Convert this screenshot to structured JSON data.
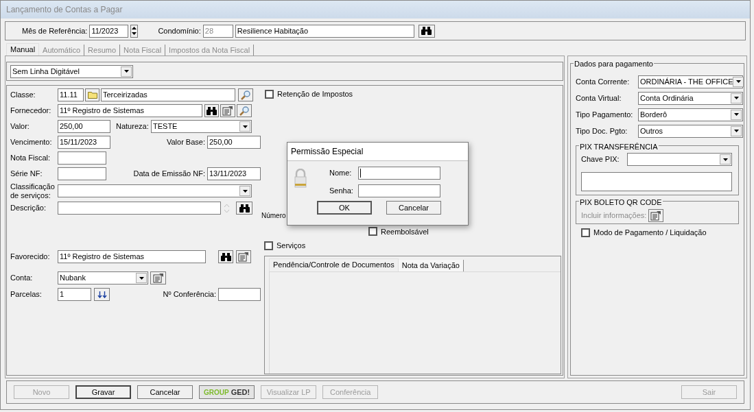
{
  "window": {
    "title": "Lançamento de Contas a Pagar"
  },
  "header": {
    "month_label": "Mês de Referência:",
    "month_value": "11/2023",
    "condo_label": "Condomínio:",
    "condo_code": "28",
    "condo_name": "Resilience Habitação"
  },
  "tabs": [
    {
      "label": "Manual",
      "selected": true
    },
    {
      "label": "Automático",
      "selected": false
    },
    {
      "label": "Resumo",
      "selected": false
    },
    {
      "label": "Nota Fiscal",
      "selected": false
    },
    {
      "label": "Impostos da Nota Fiscal",
      "selected": false
    }
  ],
  "line_type": {
    "value": "Sem Linha Digitável"
  },
  "form": {
    "classe": {
      "label": "Classe:",
      "code": "11.11",
      "name": "Terceirizadas"
    },
    "fornecedor": {
      "label": "Fornecedor:",
      "value": "11º Registro de Sistemas"
    },
    "valor": {
      "label": "Valor:",
      "value": "250,00"
    },
    "natureza": {
      "label": "Natureza:",
      "value": "TESTE"
    },
    "vencimento": {
      "label": "Vencimento:",
      "value": "15/11/2023"
    },
    "valor_base": {
      "label": "Valor Base:",
      "value": "250,00"
    },
    "nota_fiscal": {
      "label": "Nota Fiscal:"
    },
    "serie_nf": {
      "label": "Série NF:"
    },
    "data_emissao": {
      "label": "Data de Emissão NF:",
      "value": "13/11/2023"
    },
    "classificacao": {
      "label": "Classificação de serviços:"
    },
    "descricao": {
      "label": "Descrição:"
    },
    "favorecido": {
      "label": "Favorecido:",
      "value": "11º Registro de Sistemas"
    },
    "conta": {
      "label": "Conta:",
      "value": "Nubank"
    },
    "parcelas": {
      "label": "Parcelas:",
      "value": "1"
    },
    "conferencia": {
      "label": "Nº Conferência:"
    }
  },
  "options": {
    "retencao": {
      "label": "Retenção de Impostos",
      "checked": false
    },
    "numero_label": "Número",
    "reembolsavel": {
      "label": "Reembolsável",
      "checked": false
    },
    "servicos": {
      "label": "Serviços",
      "checked": false
    }
  },
  "subtabs": [
    {
      "label": "Pendência/Controle de Documentos",
      "selected": true
    },
    {
      "label": "Nota da Variação",
      "selected": false
    }
  ],
  "dialog": {
    "title": "Permissão Especial",
    "fields": [
      {
        "label": "Nome:"
      },
      {
        "label": "Senha:"
      }
    ],
    "buttons": [
      {
        "label": "OK",
        "default": true
      },
      {
        "label": "Cancelar",
        "default": false
      }
    ]
  },
  "payment": {
    "title": "Dados para pagamento",
    "selects": [
      {
        "label": "Conta Corrente:",
        "value": "ORDINÁRIA - THE OFFICE"
      },
      {
        "label": "Conta Virtual:",
        "value": "Conta Ordinária"
      },
      {
        "label": "Tipo Pagamento:",
        "value": "Borderô"
      },
      {
        "label": "Tipo Doc. Pgto:",
        "value": "Outros"
      }
    ],
    "pix": {
      "title": "PIX TRANSFERÊNCIA",
      "key_label": "Chave PIX:"
    },
    "boleto": {
      "title": "PIX BOLETO QR CODE",
      "label": "Incluir informações:",
      "disabled": true
    },
    "liquidacao": {
      "label": "Modo de Pagamento / Liquidação",
      "checked": false
    }
  },
  "buttons": [
    {
      "kind": "button",
      "label": "Novo",
      "disabled": true,
      "default": false
    },
    {
      "kind": "button",
      "label": "Gravar",
      "disabled": false,
      "default": true
    },
    {
      "kind": "button",
      "label": "Cancelar",
      "disabled": false,
      "default": false
    },
    {
      "kind": "logo",
      "label": "GROUP",
      "label2": "GED!",
      "disabled": false,
      "default": false
    },
    {
      "kind": "button",
      "label": "Visualizar LP",
      "disabled": true,
      "default": false
    },
    {
      "kind": "button",
      "label": "Conferência",
      "disabled": true,
      "default": false
    },
    {
      "kind": "button",
      "label": "Sair",
      "disabled": true,
      "default": false
    }
  ]
}
